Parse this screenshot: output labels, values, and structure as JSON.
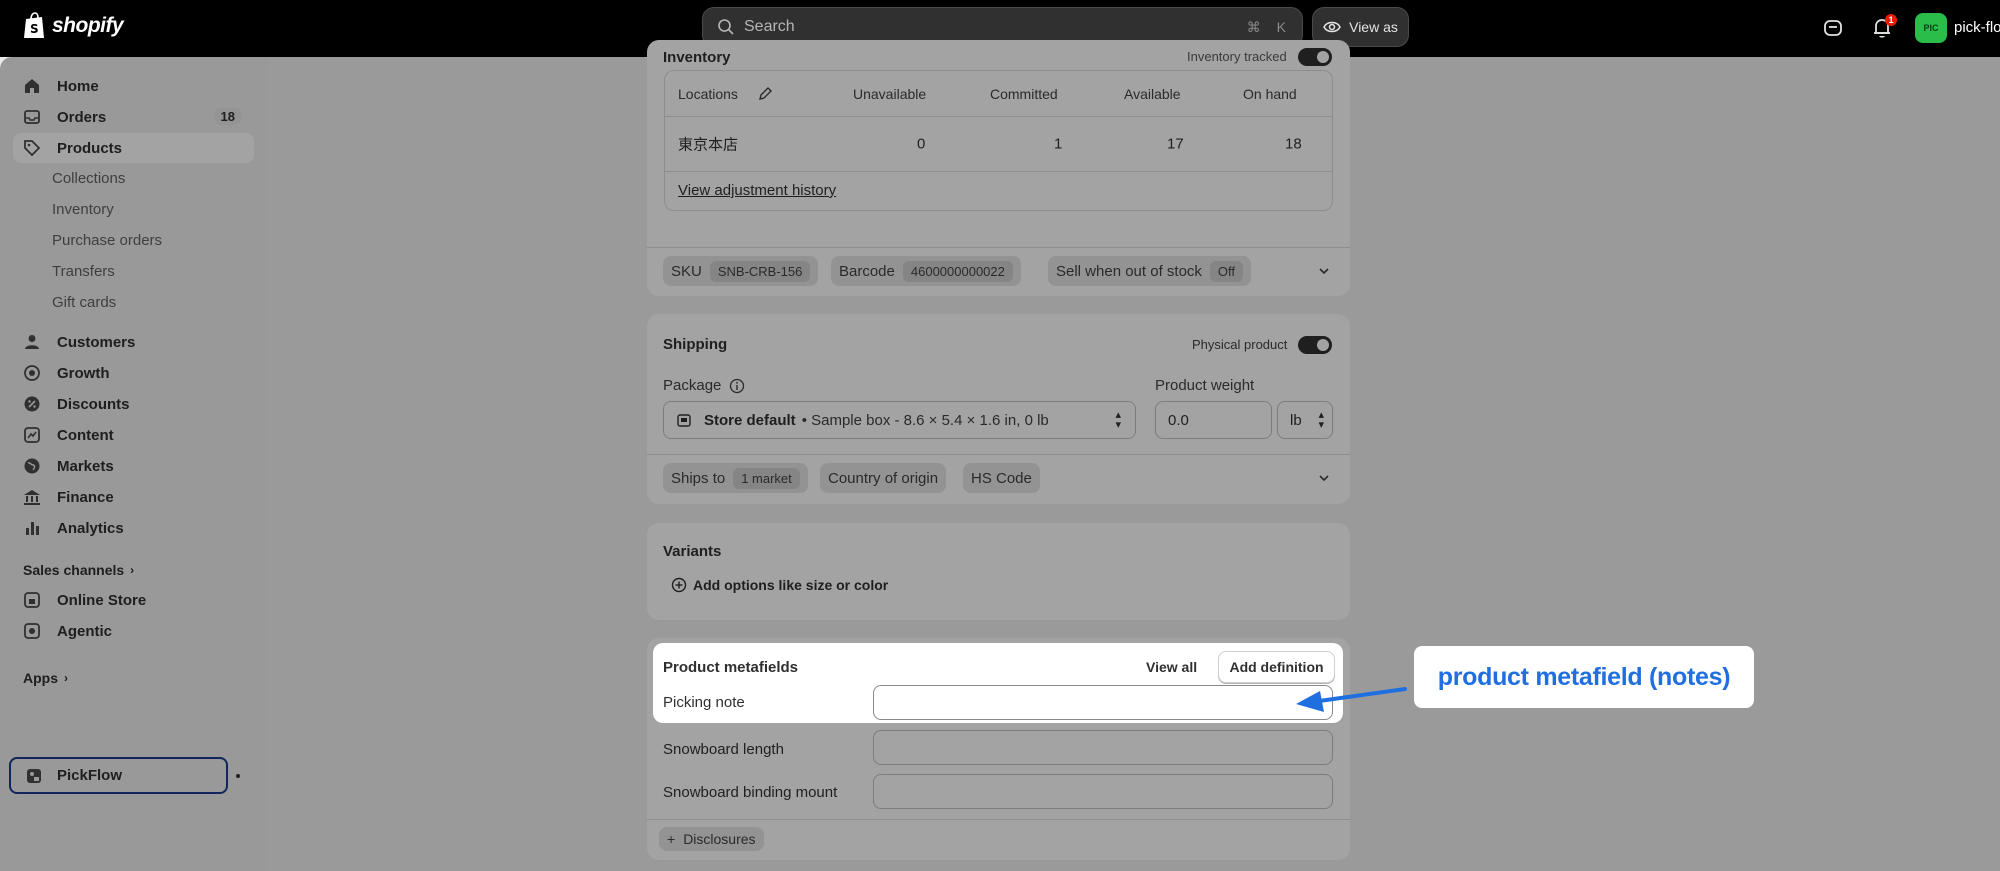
{
  "topbar": {
    "brand": "shopify",
    "search_placeholder": "Search",
    "shortcut_cmd": "⌘",
    "shortcut_key": "K",
    "view_as": "View as",
    "notification_count": "1",
    "avatar_initials": "PIC",
    "store_name": "pick-flo"
  },
  "sidebar": {
    "items": [
      {
        "label": "Home",
        "icon": "home-icon"
      },
      {
        "label": "Orders",
        "icon": "inbox-icon",
        "count": "18"
      },
      {
        "label": "Products",
        "icon": "tag-icon"
      },
      {
        "label": "Customers",
        "icon": "person-icon"
      },
      {
        "label": "Growth",
        "icon": "target-icon"
      },
      {
        "label": "Discounts",
        "icon": "discount-icon"
      },
      {
        "label": "Content",
        "icon": "content-icon"
      },
      {
        "label": "Markets",
        "icon": "globe-icon"
      },
      {
        "label": "Finance",
        "icon": "bank-icon"
      },
      {
        "label": "Analytics",
        "icon": "chart-icon"
      }
    ],
    "product_subitems": [
      "Collections",
      "Inventory",
      "Purchase orders",
      "Transfers",
      "Gift cards"
    ],
    "sales_channels_label": "Sales channels",
    "channels": [
      "Online Store",
      "Agentic"
    ],
    "apps_label": "Apps",
    "app_item": "PickFlow"
  },
  "inventory": {
    "title": "Inventory",
    "tracked_label": "Inventory tracked",
    "headers": [
      "Locations",
      "Unavailable",
      "Committed",
      "Available",
      "On hand"
    ],
    "rows": [
      {
        "location": "東京本店",
        "unavailable": "0",
        "committed": "1",
        "available": "17",
        "on_hand": "18"
      }
    ],
    "history_link": "View adjustment history",
    "sku_label": "SKU",
    "sku_value": "SNB-CRB-156",
    "barcode_label": "Barcode",
    "barcode_value": "4600000000022",
    "sell_oos_label": "Sell when out of stock",
    "sell_oos_value": "Off"
  },
  "shipping": {
    "title": "Shipping",
    "physical_label": "Physical product",
    "package_label": "Package",
    "package_value_bold": "Store default",
    "package_value_rest": "• Sample box - 8.6 × 5.4 × 1.6 in, 0 lb",
    "weight_label": "Product weight",
    "weight_value": "0.0",
    "weight_unit": "lb",
    "ships_to_label": "Ships to",
    "ships_to_value": "1 market",
    "origin_label": "Country of origin",
    "hs_label": "HS Code"
  },
  "variants": {
    "title": "Variants",
    "add_options": "Add options like size or color"
  },
  "metafields": {
    "title": "Product metafields",
    "view_all": "View all",
    "add_definition": "Add definition",
    "fields": [
      "Picking note",
      "Snowboard length",
      "Snowboard binding mount"
    ],
    "disclosures": "Disclosures"
  },
  "annotation": {
    "callout_text": "product metafield (notes)",
    "accent": "#1f6fe0"
  }
}
